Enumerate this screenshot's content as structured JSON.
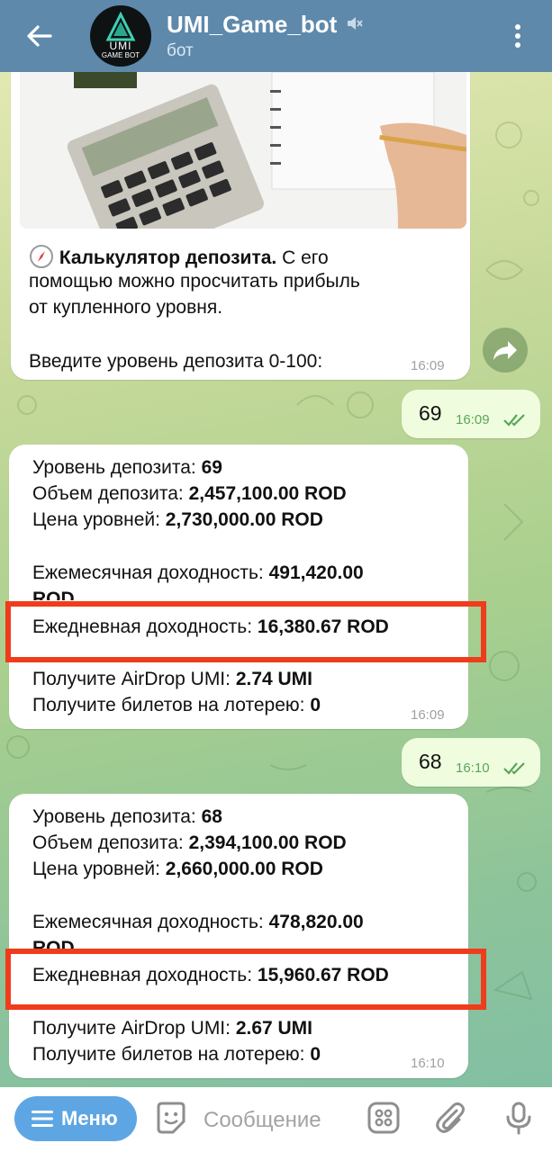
{
  "header": {
    "title": "UMI_Game_bot",
    "subtitle": "бот",
    "avatar_line1": "UMI",
    "avatar_line2": "GAME BOT"
  },
  "calc_message": {
    "emoji": "compass-icon",
    "title_bold": "Калькулятор депозита.",
    "text_1": " С его",
    "text_2": "помощью можно просчитать прибыль",
    "text_3": "от купленного уровня.",
    "text_4": "Введите уровень депозита 0-100:",
    "time": "16:09"
  },
  "user_msg_1": {
    "text": "69",
    "time": "16:09"
  },
  "result_1": {
    "level_label": "Уровень депозита: ",
    "level_value": "69",
    "volume_label": "Объем депозита: ",
    "volume_value": "2,457,100.00 ROD",
    "price_label": "Цена уровней: ",
    "price_value": "2,730,000.00 ROD",
    "monthly_label": "Ежемесячная доходность: ",
    "monthly_value": "491,420.00",
    "monthly_unit": "ROD",
    "daily_label": "Ежедневная доходность: ",
    "daily_value": "16,380.67 ROD",
    "airdrop_label": "Получите AirDrop UMI: ",
    "airdrop_value": "2.74 UMI",
    "tickets_label": "Получите билетов на лотерею: ",
    "tickets_value": "0",
    "time": "16:09"
  },
  "user_msg_2": {
    "text": "68",
    "time": "16:10"
  },
  "result_2": {
    "level_label": "Уровень депозита: ",
    "level_value": "68",
    "volume_label": "Объем депозита: ",
    "volume_value": "2,394,100.00 ROD",
    "price_label": "Цена уровней: ",
    "price_value": "2,660,000.00 ROD",
    "monthly_label": "Ежемесячная доходность: ",
    "monthly_value": "478,820.00",
    "monthly_unit": "ROD",
    "daily_label": "Ежедневная доходность: ",
    "daily_value": "15,960.67 ROD",
    "airdrop_label": "Получите AirDrop UMI: ",
    "airdrop_value": "2.67 UMI",
    "tickets_label": "Получите билетов на лотерею: ",
    "tickets_value": "0",
    "time": "16:10"
  },
  "bottom": {
    "menu_label": "Меню",
    "input_placeholder": "Сообщение"
  },
  "colors": {
    "header": "#5e89ab",
    "highlight": "#ef3c1c",
    "menu_button": "#5ea6e3",
    "outgoing_bubble": "#effdde"
  }
}
